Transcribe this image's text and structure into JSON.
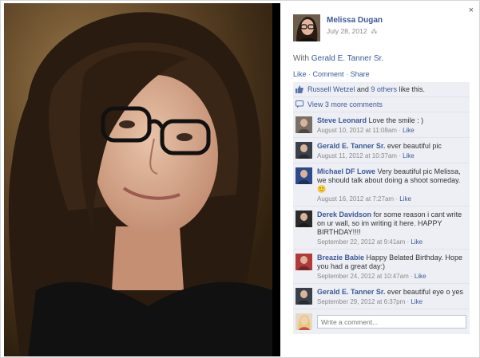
{
  "photo": {
    "icon": "portrait-photo"
  },
  "panel": {
    "close_label": "×",
    "author": {
      "name": "Melissa Dugan",
      "date": "July 28, 2012",
      "audience_icon": "friends-icon",
      "audience_glyph": "⁂"
    },
    "with_prefix": "With",
    "with_name": "Gerald E. Tanner Sr.",
    "actions": {
      "like": "Like",
      "comment": "Comment",
      "share": "Share",
      "sep": "·"
    },
    "likes": {
      "first": "Russell Wetzel",
      "joiner": "and",
      "others": "9 others",
      "suffix": "like this."
    },
    "more_comments": "View 3 more comments",
    "comments": [
      {
        "name": "Steve Leonard",
        "text": "Love the smile : )",
        "time": "August 10, 2012 at 11:08am",
        "like": "Like",
        "avatar_color": "#7a6f66"
      },
      {
        "name": "Gerald E. Tanner Sr.",
        "text": "ever beautiful pic",
        "time": "August 11, 2012 at 10:37am",
        "like": "Like",
        "avatar_color": "#3a3f4a"
      },
      {
        "name": "Michael DF Lowe",
        "text": "Very beautiful pic Melissa, we should talk about doing a shoot someday. 🙂",
        "time": "August 16, 2012 at 7:27am",
        "like": "Like",
        "avatar_color": "#2d4a8a"
      },
      {
        "name": "Derek Davidson",
        "text": "for some reason i cant write on ur wall, so im writing it here. HAPPY BIRTHDAY!!!!",
        "time": "September 22, 2012 at 9:41am",
        "like": "Like",
        "avatar_color": "#2b2b2b"
      },
      {
        "name": "Breazie Babie",
        "text": "Happy Belated Birthday. Hope you had a great day:)",
        "time": "September 24, 2012 at 10:47am",
        "like": "Like",
        "avatar_color": "#b23a3a"
      },
      {
        "name": "Gerald E. Tanner Sr.",
        "text": "ever beautiful eye o yes",
        "time": "September 29, 2012 at 6:37pm",
        "like": "Like",
        "avatar_color": "#3a3f4a"
      }
    ],
    "compose_placeholder": "Write a comment..."
  }
}
